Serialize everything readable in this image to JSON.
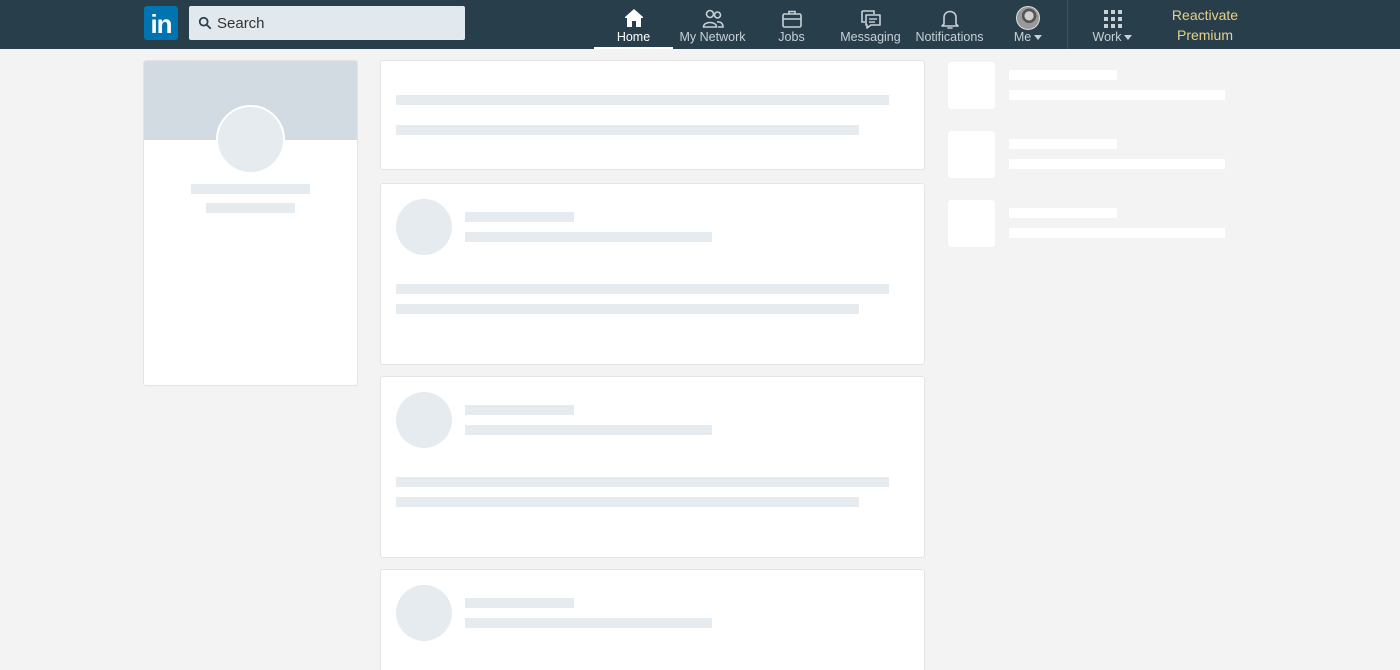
{
  "navbar": {
    "logo": "in",
    "search": {
      "placeholder": "Search",
      "value": ""
    },
    "items": [
      {
        "label": "Home",
        "icon": "home-icon",
        "active": true
      },
      {
        "label": "My Network",
        "icon": "network-icon",
        "active": false
      },
      {
        "label": "Jobs",
        "icon": "briefcase-icon",
        "active": false
      },
      {
        "label": "Messaging",
        "icon": "messaging-icon",
        "active": false
      },
      {
        "label": "Notifications",
        "icon": "bell-icon",
        "active": false
      },
      {
        "label": "Me",
        "icon": "avatar",
        "active": false,
        "dropdown": true
      },
      {
        "label": "Work",
        "icon": "grid-icon",
        "active": false,
        "dropdown": true
      }
    ],
    "premium": {
      "line1": "Reactivate",
      "line2": "Premium"
    }
  },
  "colors": {
    "navbar_bg": "#283e4a",
    "logo_bg": "#0073b1",
    "premium_text": "#e6d18a",
    "page_bg": "#f3f3f3",
    "skeleton": "#e6ebef"
  }
}
